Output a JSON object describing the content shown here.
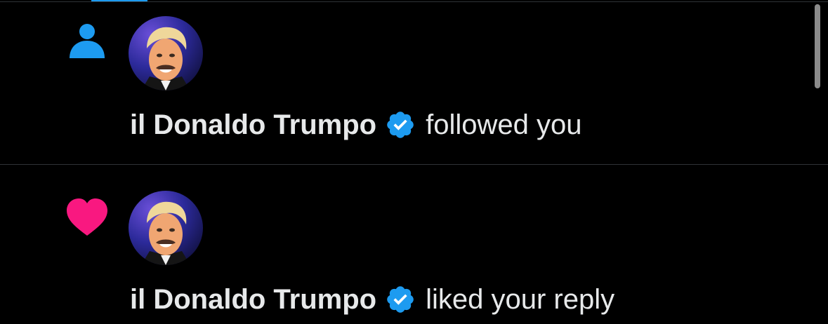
{
  "colors": {
    "background": "#000000",
    "follow_icon": "#1d9bf0",
    "like_icon": "#f91880",
    "verified_badge": "#1d9bf0",
    "divider": "#2f3336",
    "text": "#e7e9ea"
  },
  "notifications": [
    {
      "type_icon": "person-icon",
      "avatar": "user-avatar",
      "user_name": "il Donaldo Trumpo",
      "verified": true,
      "action_text": "followed you"
    },
    {
      "type_icon": "heart-icon",
      "avatar": "user-avatar",
      "user_name": "il Donaldo Trumpo",
      "verified": true,
      "action_text": "liked your reply"
    }
  ]
}
